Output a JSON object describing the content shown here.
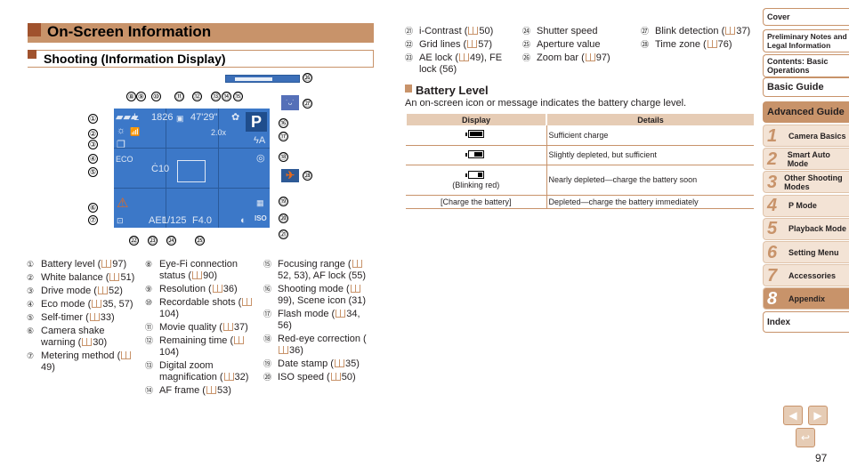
{
  "header": {
    "title": "On-Screen Information",
    "subtitle": "Shooting (Information Display)"
  },
  "screen": {
    "osd": {
      "resolution": "L",
      "shots": "1826",
      "movie": "▣",
      "remaining": "47'29\"",
      "digital_zoom": "2.0x",
      "eco": "ECO",
      "timer": "Ċ10",
      "ael": "AEL",
      "shutter": "1/125",
      "aperture": "F4.0",
      "iso": "ISO",
      "mode": "P",
      "flash": "ϟA",
      "redeye": "◎"
    },
    "zoom_fraction": 0.7,
    "callouts": [
      "①",
      "②",
      "③",
      "④",
      "⑤",
      "⑥",
      "⑦",
      "⑧",
      "⑨",
      "⑩",
      "⑪",
      "⑫",
      "⑬",
      "⑭",
      "⑮",
      "⑯",
      "⑰",
      "⑱",
      "⑲",
      "⑳",
      "㉑",
      "㉒",
      "㉓",
      "㉔",
      "㉕",
      "㉖",
      "㉗",
      "㉘"
    ]
  },
  "legend_col1": [
    {
      "num": "①",
      "text": "Battery level (",
      "ref": "97)"
    },
    {
      "num": "②",
      "text": "White balance (",
      "ref": "51)"
    },
    {
      "num": "③",
      "text": "Drive mode (",
      "ref": "52)"
    },
    {
      "num": "④",
      "text": "Eco mode (",
      "ref": "35, 57)"
    },
    {
      "num": "⑤",
      "text": "Self-timer (",
      "ref": "33)"
    },
    {
      "num": "⑥",
      "text": "Camera shake warning (",
      "ref": "30)"
    },
    {
      "num": "⑦",
      "text": "Metering method (",
      "ref": "49)"
    }
  ],
  "legend_col2": [
    {
      "num": "⑧",
      "text": "Eye-Fi connection status (",
      "ref": "90)"
    },
    {
      "num": "⑨",
      "text": "Resolution (",
      "ref": "36)"
    },
    {
      "num": "⑩",
      "text": "Recordable shots (",
      "ref": "104)"
    },
    {
      "num": "⑪",
      "text": "Movie quality (",
      "ref": "37)"
    },
    {
      "num": "⑫",
      "text": "Remaining time (",
      "ref": "104)"
    },
    {
      "num": "⑬",
      "text": "Digital zoom magnification (",
      "ref": "32)"
    },
    {
      "num": "⑭",
      "text": "AF frame (",
      "ref": "53)"
    }
  ],
  "legend_col3": [
    {
      "num": "⑮",
      "text": "Focusing range (",
      "ref": "52, 53), AF lock (55)"
    },
    {
      "num": "⑯",
      "text": "Shooting mode (",
      "ref": "99), Scene icon (31)"
    },
    {
      "num": "⑰",
      "text": "Flash mode (",
      "ref": "34, 56)"
    },
    {
      "num": "⑱",
      "text": "Red-eye correction (",
      "ref": "36)"
    },
    {
      "num": "⑲",
      "text": "Date stamp (",
      "ref": "35)"
    },
    {
      "num": "⑳",
      "text": "ISO speed (",
      "ref": "50)"
    }
  ],
  "legend_col4": [
    {
      "num": "㉑",
      "text": "i-Contrast (",
      "ref": "50)"
    },
    {
      "num": "㉒",
      "text": "Grid lines (",
      "ref": "57)"
    },
    {
      "num": "㉓",
      "text": "AE lock (",
      "ref": "49), FE lock (56)"
    }
  ],
  "legend_col5": [
    {
      "num": "㉔",
      "text": "Shutter speed",
      "ref": ""
    },
    {
      "num": "㉕",
      "text": "Aperture value",
      "ref": ""
    },
    {
      "num": "㉖",
      "text": "Zoom bar (",
      "ref": "97)"
    }
  ],
  "legend_col6": [
    {
      "num": "㉗",
      "text": "Blink detection (",
      "ref": "37)"
    },
    {
      "num": "㉘",
      "text": "Time zone (",
      "ref": "76)"
    }
  ],
  "battery": {
    "heading": "Battery Level",
    "description": "An on-screen icon or message indicates the battery charge level.",
    "columns": [
      "Display",
      "Details"
    ],
    "rows": [
      {
        "display": "",
        "level": 1.0,
        "details": "Sufficient charge"
      },
      {
        "display": "",
        "level": 0.66,
        "details": "Slightly depleted, but sufficient"
      },
      {
        "display": "(Blinking red)",
        "level": 0.33,
        "details": "Nearly depleted—charge the battery soon"
      },
      {
        "display": "[Charge the battery]",
        "level": null,
        "details": "Depleted—charge the battery immediately"
      }
    ]
  },
  "sidebar": {
    "cover": "Cover",
    "prelim": "Preliminary Notes and Legal Information",
    "contents": "Contents: Basic Operations",
    "basic": "Basic Guide",
    "advanced": "Advanced Guide",
    "chapters": [
      {
        "n": "1",
        "label": "Camera Basics"
      },
      {
        "n": "2",
        "label": "Smart Auto Mode"
      },
      {
        "n": "3",
        "label": "Other Shooting Modes"
      },
      {
        "n": "4",
        "label": "P Mode"
      },
      {
        "n": "5",
        "label": "Playback Mode"
      },
      {
        "n": "6",
        "label": "Setting Menu"
      },
      {
        "n": "7",
        "label": "Accessories"
      },
      {
        "n": "8",
        "label": "Appendix"
      }
    ],
    "index": "Index"
  },
  "nav": {
    "prev": "◀",
    "next": "▶",
    "back": "↩"
  },
  "page_number": "97"
}
